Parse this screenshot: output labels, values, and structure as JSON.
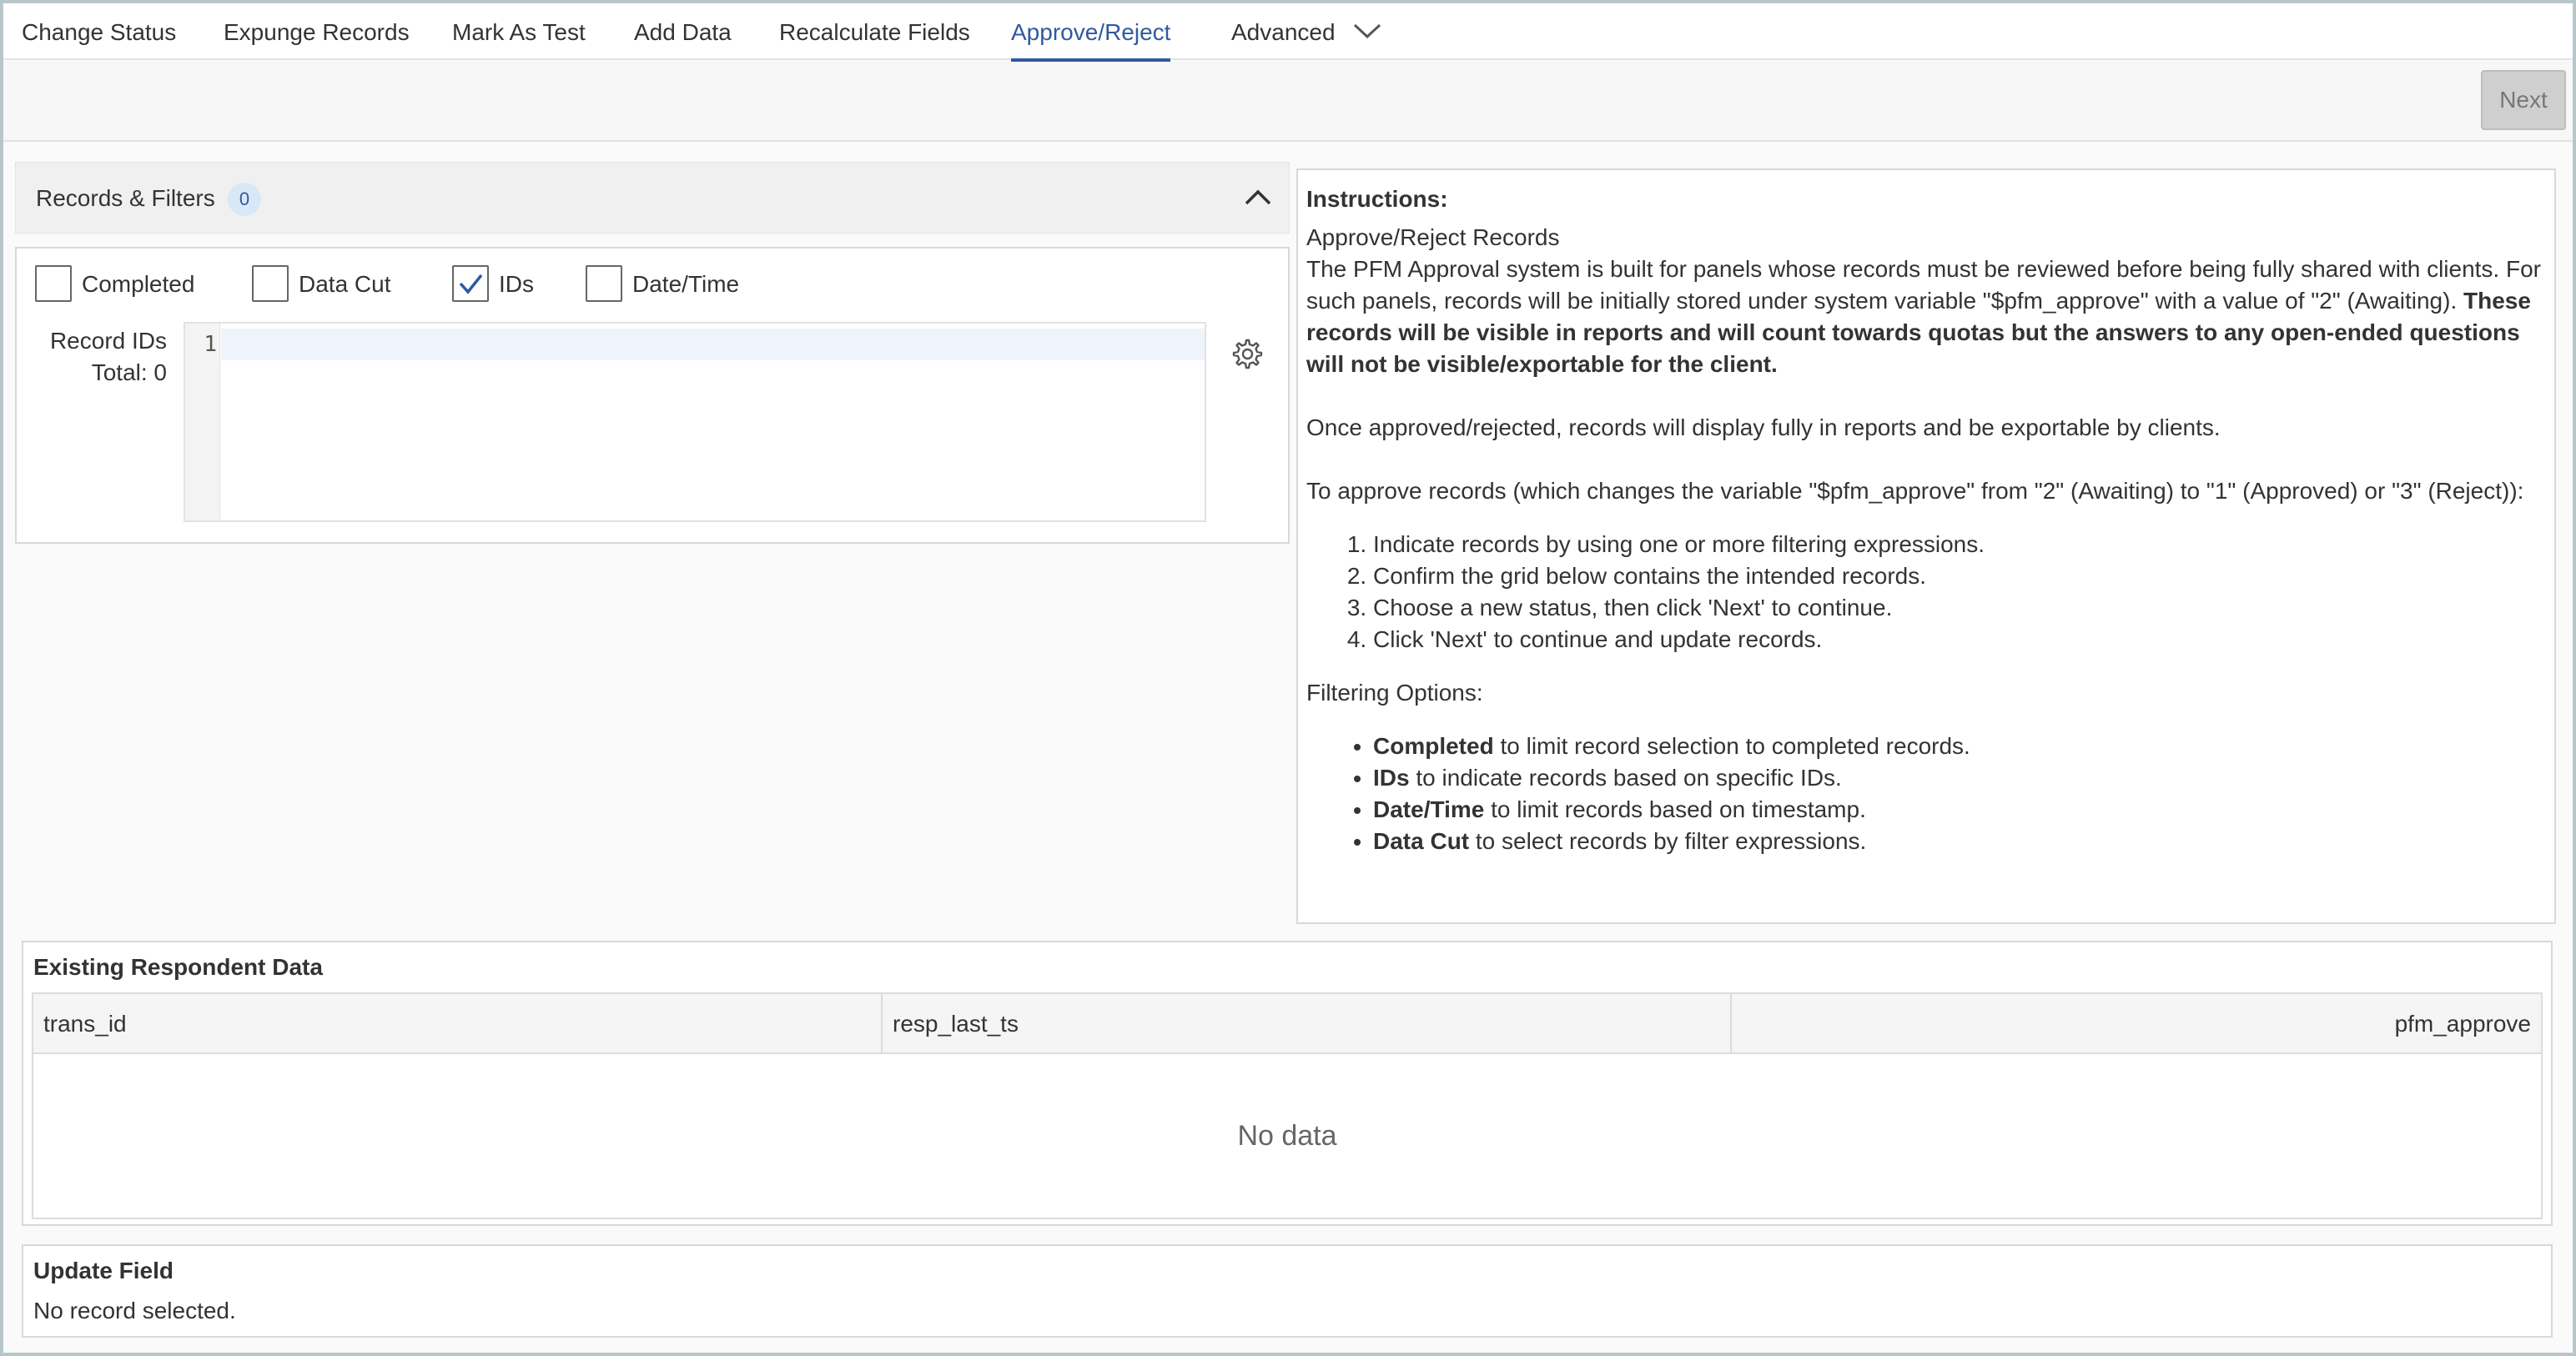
{
  "tabs": [
    {
      "label": "Change Status"
    },
    {
      "label": "Expunge Records"
    },
    {
      "label": "Mark As Test"
    },
    {
      "label": "Add Data"
    },
    {
      "label": "Recalculate Fields"
    },
    {
      "label": "Approve/Reject",
      "active": true
    },
    {
      "label": "Advanced"
    }
  ],
  "toolbar": {
    "next_label": "Next"
  },
  "records_filters": {
    "title": "Records & Filters",
    "count": "0",
    "filters": [
      {
        "label": "Completed",
        "checked": false
      },
      {
        "label": "Data Cut",
        "checked": false
      },
      {
        "label": "IDs",
        "checked": true
      },
      {
        "label": "Date/Time",
        "checked": false
      }
    ],
    "record_ids_label": "Record IDs",
    "total_label": "Total: 0",
    "editor_line_number": "1"
  },
  "instructions": {
    "heading": "Instructions:",
    "subtitle": "Approve/Reject Records",
    "para1": "The PFM Approval system is built for panels whose records must be reviewed before being fully shared with clients. For such panels, records will be initially stored under system variable \"$pfm_approve\" with a value of \"2\" (Awaiting). ",
    "para1_bold": "These records will be visible in reports and will count towards quotas but the answers to any open-ended questions will not be visible/exportable for the client.",
    "para2": "Once approved/rejected, records will display fully in reports and be exportable by clients.",
    "para3": "To approve records (which changes the variable \"$pfm_approve\" from \"2\" (Awaiting) to \"1\" (Approved) or \"3\" (Reject)):",
    "steps": [
      "Indicate records by using one or more filtering expressions.",
      "Confirm the grid below contains the intended records.",
      "Choose a new status, then click 'Next' to continue.",
      "Click 'Next' to continue and update records."
    ],
    "filtering_heading": "Filtering Options:",
    "options": [
      {
        "term": "Completed",
        "desc": " to limit record selection to completed records."
      },
      {
        "term": "IDs",
        "desc": " to indicate records based on specific IDs."
      },
      {
        "term": "Date/Time",
        "desc": " to limit records based on timestamp."
      },
      {
        "term": "Data Cut",
        "desc": " to select records by filter expressions."
      }
    ]
  },
  "existing_data": {
    "title": "Existing Respondent Data",
    "columns": [
      "trans_id",
      "resp_last_ts",
      "pfm_approve"
    ],
    "empty_text": "No data"
  },
  "update_field": {
    "title": "Update Field",
    "message": "No record selected."
  },
  "colors": {
    "accent": "#2f5aa0",
    "badge_bg": "#d9e8f6"
  }
}
